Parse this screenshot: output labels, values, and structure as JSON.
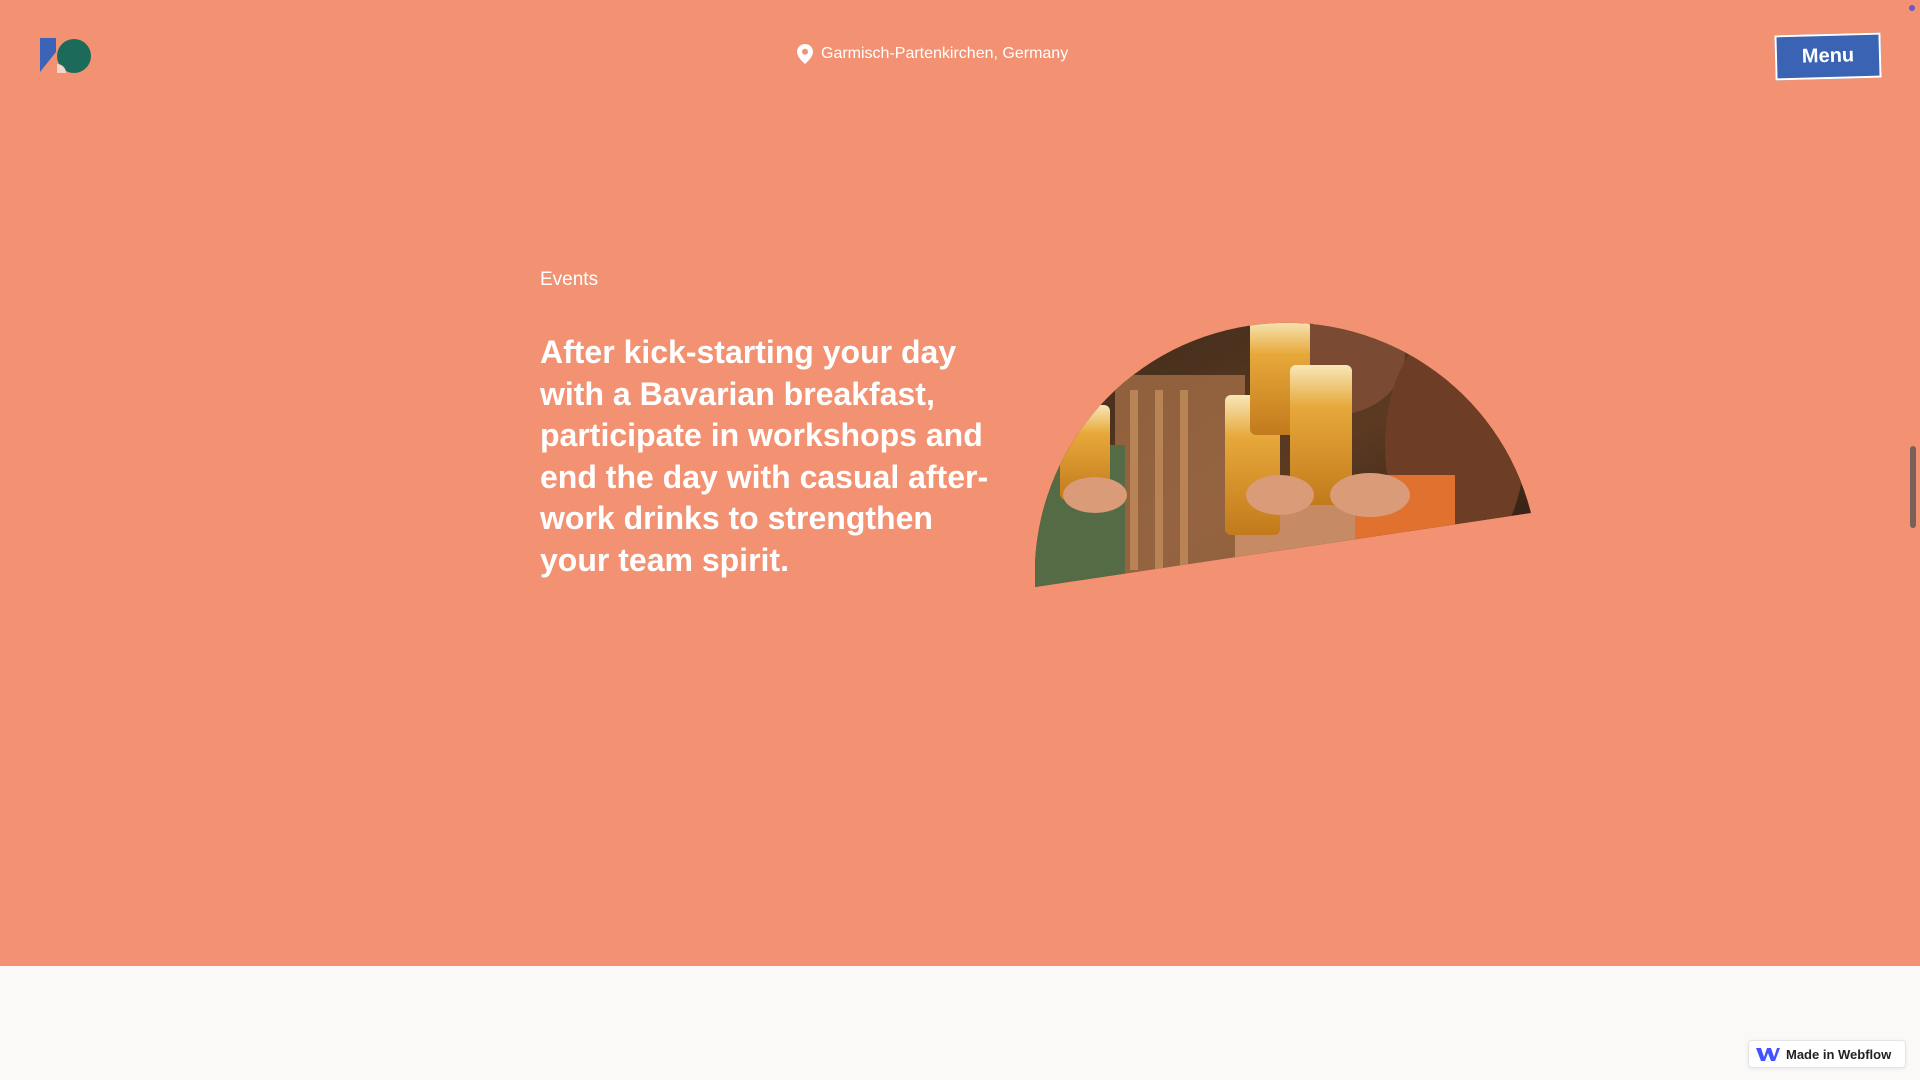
{
  "header": {
    "location_text": "Garmisch-Partenkirchen, Germany",
    "menu_label": "Menu"
  },
  "section": {
    "eyebrow": "Events",
    "headline": "After kick-starting your day with a Bavarian breakfast, participate in workshops and end the day with casual after-work drinks to strengthen your team spirit."
  },
  "badge": {
    "label": "Made in Webflow"
  },
  "icons": {
    "logo": "brand-logo-icon",
    "location": "map-pin-icon",
    "webflow": "webflow-logo-icon"
  },
  "colors": {
    "hero_background": "#f29272",
    "page_background": "#fbf9f7",
    "menu_button": "#3a63b3",
    "logo_blue": "#3b63b8",
    "logo_green": "#1c6b5a",
    "webflow_blue": "#4353ff"
  }
}
